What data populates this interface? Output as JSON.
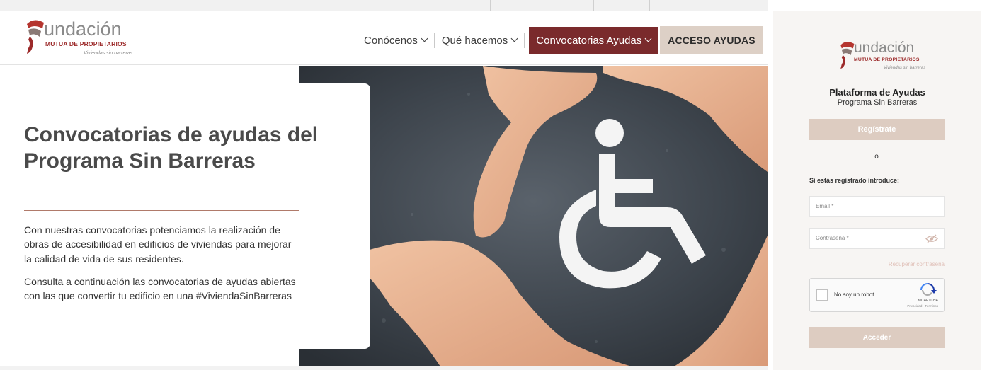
{
  "brand": {
    "word": "undación",
    "subtitle": "MUTUA DE PROPIETARIOS",
    "tagline": "Viviendas sin barreras",
    "accent_color": "#7a2a2c",
    "button_color": "#ddd0c6"
  },
  "nav": {
    "items": [
      {
        "label": "Conócenos"
      },
      {
        "label": "Qué hacemos"
      },
      {
        "label": "Convocatorias Ayudas"
      }
    ],
    "cta_label": "ACCESO AYUDAS"
  },
  "hero": {
    "title": "Convocatorias de ayudas del Programa Sin Barreras",
    "paragraph1": "Con nuestras convocatorias potenciamos la realización de obras de accesibilidad en edificios de viviendas para mejorar la calidad de vida de sus residentes.",
    "paragraph2": "Consulta a continuación las convocatorias de ayudas abiertas con las que convertir tu edificio en una #ViviendaSinBarreras"
  },
  "panel": {
    "title": "Plataforma de Ayudas",
    "subtitle": "Programa Sin Barreras",
    "register_label": "Regístrate",
    "or_label": "o",
    "intro": "Si estás registrado introduce:",
    "email_placeholder": "Email *",
    "password_placeholder": "Contraseña *",
    "recover_label": "Recuperar contraseña",
    "captcha_label": "No soy un robot",
    "captcha_brand": "reCAPTCHA",
    "captcha_terms": "Privacidad - Términos",
    "login_label": "Acceder"
  }
}
